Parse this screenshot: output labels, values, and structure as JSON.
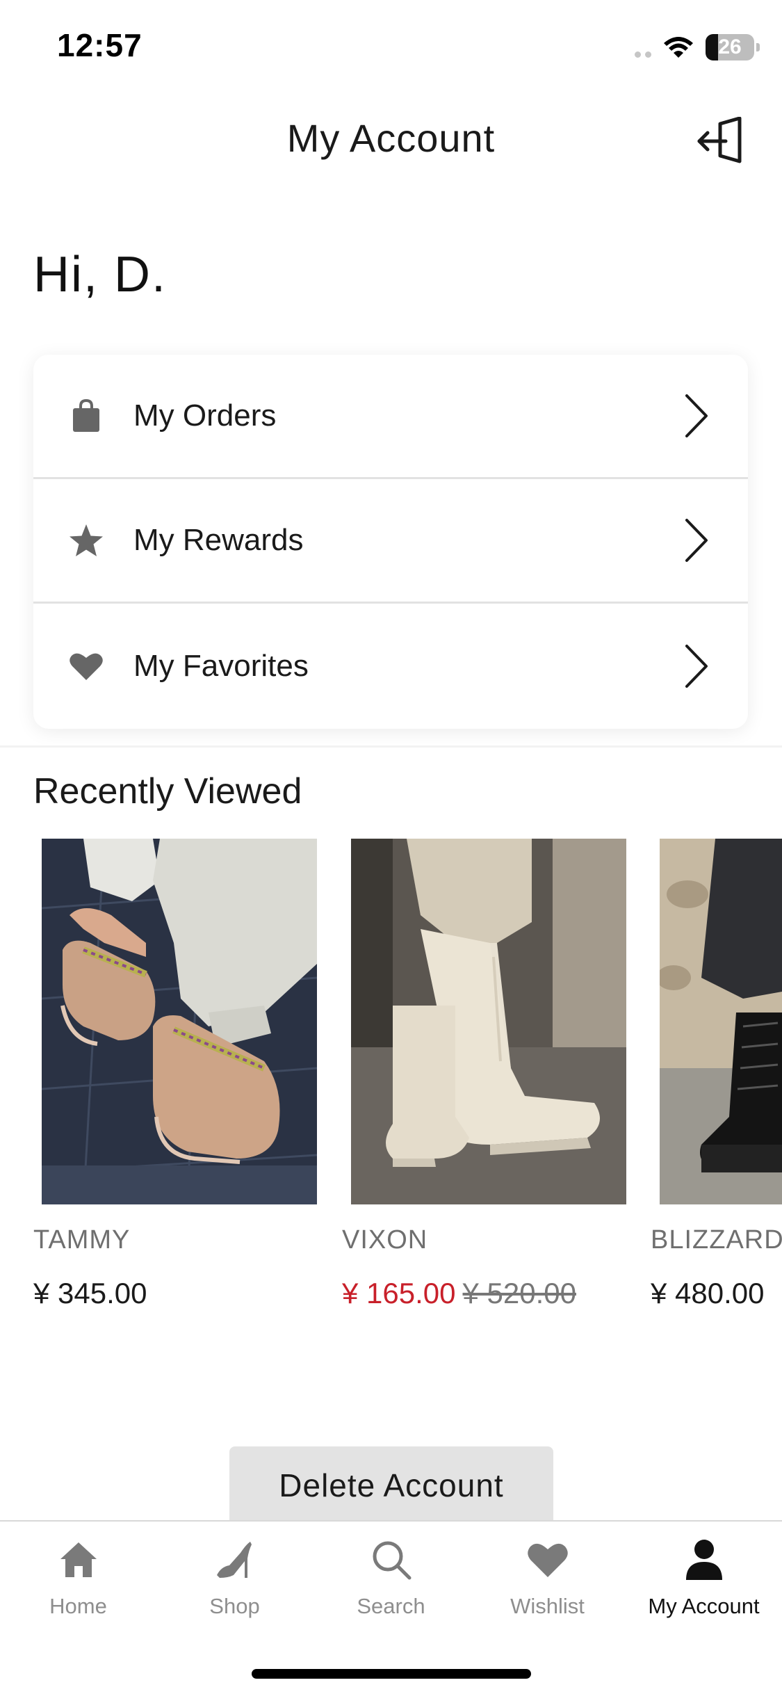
{
  "status_bar": {
    "time": "12:57",
    "battery": "26",
    "battery_fraction": 0.26
  },
  "header": {
    "title": "My Account",
    "logout_icon": "logout-icon"
  },
  "greeting": "Hi,  D.",
  "menu": [
    {
      "label": "My Orders",
      "icon": "shopping-bag-icon"
    },
    {
      "label": "My Rewards",
      "icon": "star-icon"
    },
    {
      "label": "My Favorites",
      "icon": "heart-icon"
    }
  ],
  "recently_viewed": {
    "title": "Recently Viewed",
    "products": [
      {
        "name": "TAMMY",
        "price": "¥ 345.00",
        "on_sale": false
      },
      {
        "name": "VIXON",
        "sale_price": "¥ 165.00",
        "original_price": "¥ 520.00",
        "on_sale": true
      },
      {
        "name": "BLIZZARD",
        "price": "¥ 480.00",
        "on_sale": false
      }
    ]
  },
  "delete_account_label": "Delete Account",
  "tab_bar": {
    "tabs": [
      {
        "label": "Home",
        "icon": "home-icon",
        "active": false
      },
      {
        "label": "Shop",
        "icon": "high-heel-icon",
        "active": false
      },
      {
        "label": "Search",
        "icon": "search-icon",
        "active": false
      },
      {
        "label": "Wishlist",
        "icon": "heart-icon",
        "active": false
      },
      {
        "label": "My Account",
        "icon": "person-icon",
        "active": true
      }
    ]
  },
  "colors": {
    "sale_red": "#c8202a",
    "icon_gray": "#666666",
    "tab_inactive": "#8e8e8e"
  }
}
